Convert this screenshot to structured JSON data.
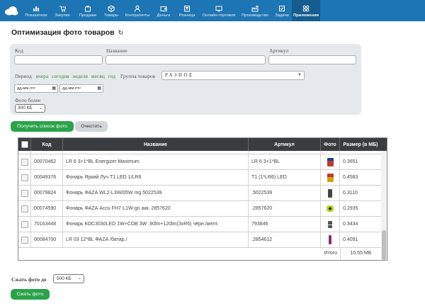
{
  "nav": {
    "items": [
      {
        "label": "Показатели",
        "icon": "chart-icon"
      },
      {
        "label": "Закупки",
        "icon": "purchases-icon"
      },
      {
        "label": "Продажи",
        "icon": "sales-icon"
      },
      {
        "label": "Товары",
        "icon": "products-icon"
      },
      {
        "label": "Контрагенты",
        "icon": "contacts-icon"
      },
      {
        "label": "Деньги",
        "icon": "wallet-icon"
      },
      {
        "label": "Розница",
        "icon": "retail-icon"
      },
      {
        "label": "Онлайн-торговля",
        "icon": "online-store-icon"
      },
      {
        "label": "Производство",
        "icon": "production-icon"
      },
      {
        "label": "Задачи",
        "icon": "tasks-icon"
      },
      {
        "label": "Приложения",
        "icon": "apps-icon"
      }
    ],
    "active": "Приложения",
    "colors": {
      "bar": "#1e75b3",
      "active": "#155c8f"
    }
  },
  "page": {
    "title": "Оптимизация фото товаров"
  },
  "filters": {
    "code_label": "Код",
    "code_value": "",
    "name_label": "Название",
    "name_value": "",
    "article_label": "Артикул",
    "article_value": "",
    "period_label": "Период",
    "period_links": {
      "yesterday": "вчера",
      "today": "сегодня",
      "week": "неделя",
      "month": "месяц",
      "year": "год"
    },
    "group_label": "Группа товаров",
    "group_value": "РАЗНОЕ",
    "date_from_placeholder": "дд.мм.гггг",
    "date_to_placeholder": "дд.мм.гггг",
    "photo_size_label": "Фото более",
    "photo_size_value": "300 КБ"
  },
  "buttons": {
    "get_list": "Получить список фото",
    "clear": "Очистить",
    "compress": "Сжать фото"
  },
  "table": {
    "headers": {
      "code": "Код",
      "name": "Название",
      "article": "Артикул",
      "photo": "Фото",
      "size": "Размер (в МБ)"
    },
    "rows": [
      {
        "code": "00070462",
        "name": "LR 6 3+1*BL Energizer Maximum",
        "article": "LR 6 3+1*BL",
        "size": "0.3651",
        "photo_color": "#c0392b"
      },
      {
        "code": "00049376",
        "name": "Фонарь Яркий Луч T1 LED 1/LR6",
        "article": "T1 (1*LR6) LED",
        "size": "0.4583",
        "photo_color": "#d4a017"
      },
      {
        "code": "00079824",
        "name": "Фонарь ФАZА WL2-L3W/05W mg 5022539",
        "article": ".5022539",
        "size": "0.3110",
        "photo_color": "#444444"
      },
      {
        "code": "00074590",
        "name": "Фонарь ФАZА Accu FH7-L1W-gn акк. 2857620",
        "article": ".2857620",
        "size": "0.2935",
        "photo_color": "#9acd32"
      },
      {
        "code": "70163448",
        "name": "Фонарь КОС3030LED 1W+COB 3W .90lm+120lm(3xR6) чёрн./желт.",
        "article": "793846",
        "size": "0.3434",
        "photo_color": "#555555"
      },
      {
        "code": "00084700",
        "name": "LR 03 12*BL ФАZА /батар./",
        "article": ".2854612",
        "size": "0.4091",
        "photo_color": "#8e2c6b"
      }
    ],
    "total_label": "Итого",
    "total_value": "10.55 МБ"
  },
  "compress": {
    "label": "Сжать фото до",
    "value": "500 КБ"
  }
}
